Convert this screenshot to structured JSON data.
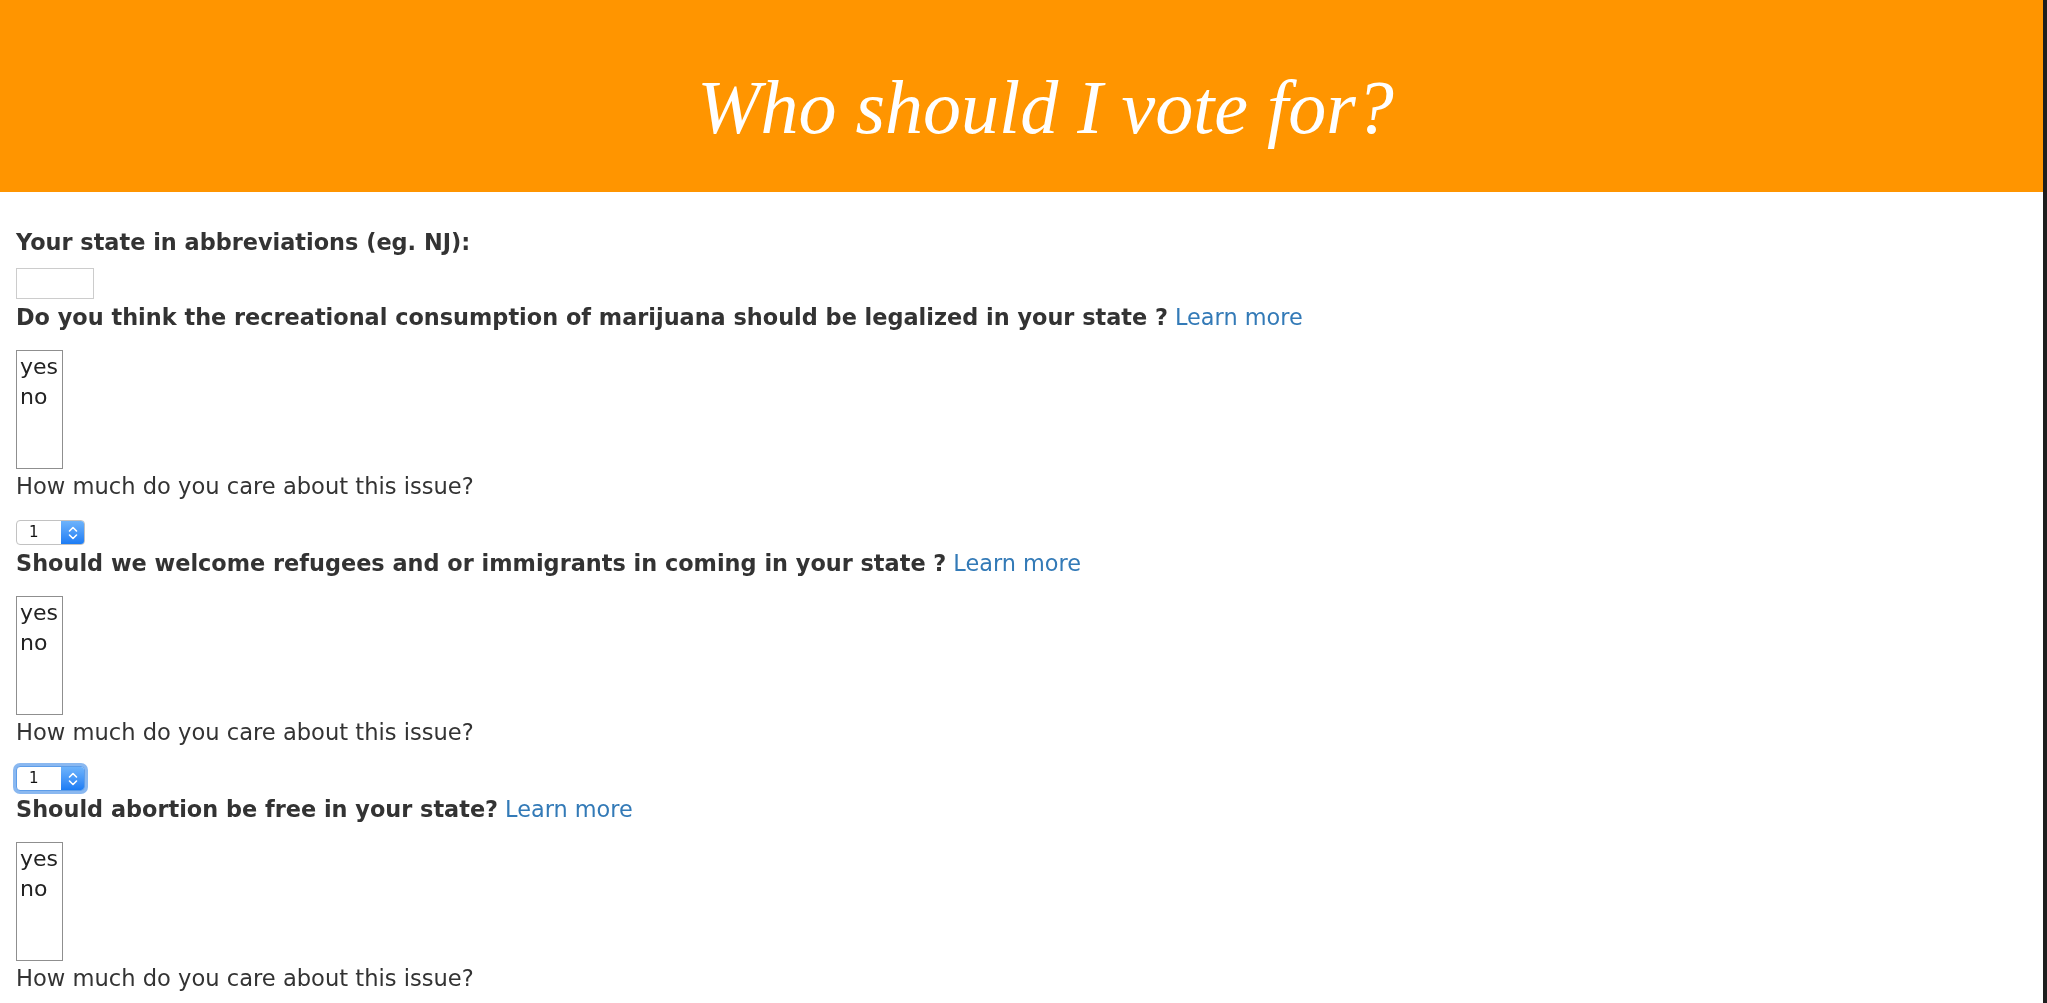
{
  "header": {
    "title": "Who should I vote for?"
  },
  "state_field": {
    "label": "Your state in abbreviations (eg. NJ):"
  },
  "questions": [
    {
      "text": "Do you think the recreational consumption of marijuana should be legalized in your state ?",
      "link": "Learn more",
      "options": [
        {
          "label": "yes",
          "selected": false
        },
        {
          "label": "no",
          "selected": false
        }
      ],
      "care_label": "How much do you care about this issue?",
      "rating": {
        "value": "1",
        "focused": false
      }
    },
    {
      "text": "Should we welcome refugees and or immigrants in coming in your state ?",
      "link": "Learn more",
      "options": [
        {
          "label": "yes",
          "selected": false
        },
        {
          "label": "no",
          "selected": false
        }
      ],
      "care_label": "How much do you care about this issue?",
      "rating": {
        "value": "1",
        "focused": true
      }
    },
    {
      "text": "Should abortion be free in your state?",
      "link": "Learn more",
      "options": [
        {
          "label": "yes",
          "selected": false
        },
        {
          "label": "no",
          "selected": false
        }
      ],
      "care_label": "How much do you care about this issue?"
    }
  ]
}
